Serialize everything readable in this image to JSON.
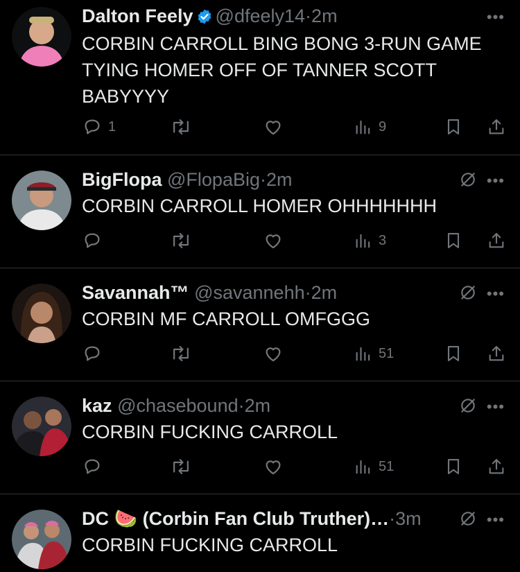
{
  "tweets": [
    {
      "name": "Dalton Feely",
      "verified": true,
      "handle": "@dfeely14",
      "sep": "·",
      "time": "2m",
      "text": "CORBIN CARROLL BING BONG 3-RUN GAME TYING HOMER OFF OF TANNER SCOTT BABYYYY",
      "replies": "1",
      "views": "9"
    },
    {
      "name": "BigFlopa",
      "handle": "@FlopaBig",
      "sep": "·",
      "time": "2m",
      "text": "CORBIN CARROLL HOMER OHHHHHHH",
      "replies": "",
      "views": "3"
    },
    {
      "name": "Savannah™",
      "handle": "@savannehh",
      "sep": "·",
      "time": "2m",
      "text": "CORBIN MF CARROLL OMFGGG",
      "replies": "",
      "views": "51"
    },
    {
      "name": "kaz",
      "handle": "@chasebound",
      "sep": "·",
      "time": "2m",
      "text": "CORBIN FUCKING CARROLL",
      "replies": "",
      "views": "51"
    },
    {
      "name": "DC 🍉 (Corbin Fan Club Truther)…",
      "handle": "",
      "sep": "·",
      "time": "3m",
      "text": "CORBIN FUCKING CARROLL",
      "replies": "",
      "views": ""
    }
  ],
  "icons": {
    "more": "more-icon",
    "grok": "grok-icon",
    "reply": "reply-icon",
    "retweet": "retweet-icon",
    "like": "like-icon",
    "views": "views-icon",
    "bookmark": "bookmark-icon",
    "share": "share-icon"
  },
  "colors": {
    "background": "#000000",
    "text": "#e7e9ea",
    "muted": "#71767b",
    "verified": "#1d9bf0",
    "divider": "#2f3336"
  }
}
